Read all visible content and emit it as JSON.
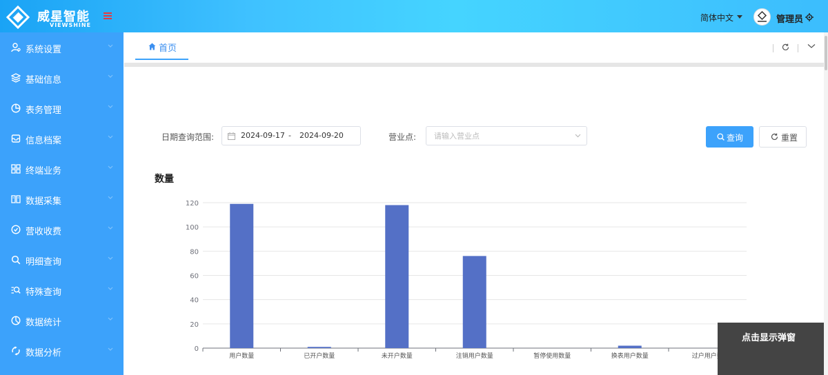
{
  "brand": {
    "name_cn": "威星智能",
    "name_en": "VIEWSHINE"
  },
  "header": {
    "language": "简体中文",
    "user": "管理员"
  },
  "sidebar": {
    "items": [
      {
        "label": "系统设置",
        "icon": "user-settings-icon"
      },
      {
        "label": "基础信息",
        "icon": "layers-icon"
      },
      {
        "label": "表务管理",
        "icon": "pie-icon"
      },
      {
        "label": "信息档案",
        "icon": "inbox-icon"
      },
      {
        "label": "终端业务",
        "icon": "terminal-grid-icon"
      },
      {
        "label": "数据采集",
        "icon": "book-icon"
      },
      {
        "label": "营收收费",
        "icon": "coin-icon"
      },
      {
        "label": "明细查询",
        "icon": "search-icon"
      },
      {
        "label": "特殊查询",
        "icon": "special-search-icon"
      },
      {
        "label": "数据统计",
        "icon": "chart-pie-icon"
      },
      {
        "label": "数据分析",
        "icon": "analysis-icon"
      }
    ]
  },
  "tabs": {
    "home": "首页"
  },
  "filters": {
    "date_label": "日期查询范围:",
    "start_date": "2024-09-17",
    "separator": "-",
    "end_date": "2024-09-20",
    "site_label": "营业点:",
    "site_placeholder": "请输入营业点",
    "query_button": "查询",
    "reset_button": "重置"
  },
  "chart_data": {
    "type": "bar",
    "title": "数量",
    "categories": [
      "用户数量",
      "已开户数量",
      "未开户数量",
      "注销用户数量",
      "暂停使用数量",
      "换表用户数量",
      "过户用户数"
    ],
    "values": [
      119,
      1,
      118,
      76,
      0,
      2,
      0
    ],
    "ylim": [
      0,
      120
    ],
    "yticks": [
      0,
      20,
      40,
      60,
      80,
      100,
      120
    ],
    "grid": true,
    "color": "#5470c6"
  },
  "popup": {
    "label": "点击显示弹窗"
  },
  "colors": {
    "accent": "#3ca2fb",
    "header": "#3fc1ff",
    "bar": "#5470c6"
  }
}
